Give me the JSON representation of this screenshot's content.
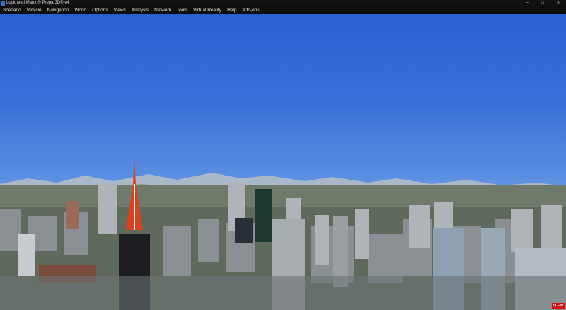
{
  "window": {
    "title": "Lockheed Martin® Prepar3D® v4"
  },
  "menu": [
    "Scenario",
    "Vehicle",
    "Navigation",
    "World",
    "Options",
    "Views",
    "Analysis",
    "Network",
    "Tools",
    "Virtual Reality",
    "Help",
    "Add-ons"
  ],
  "status": {
    "slew_badge": "SLEW"
  },
  "colors": {
    "sky_top": "#2a5fd0",
    "horizon": "#b9cfe8",
    "tower_red": "#d8421f",
    "slew_red": "#d81010"
  }
}
